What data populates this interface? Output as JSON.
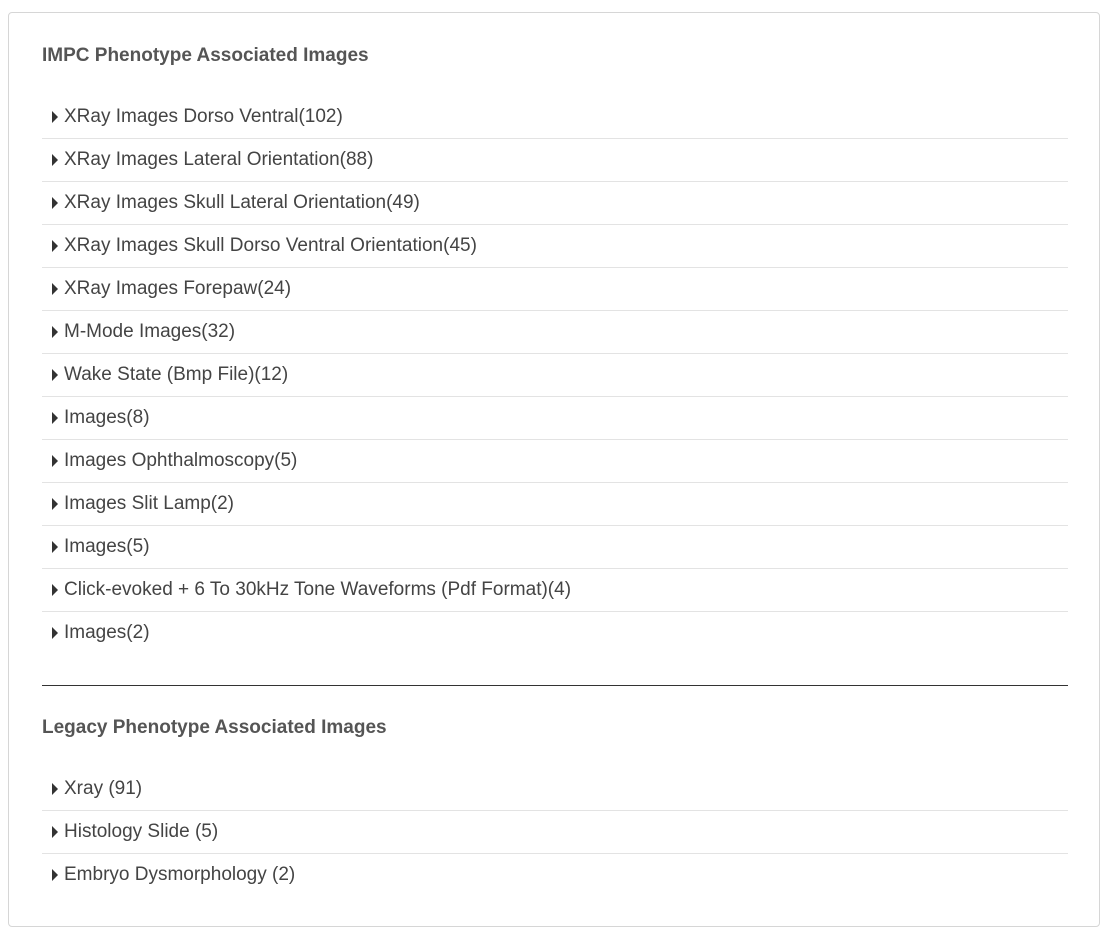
{
  "impc": {
    "title": "IMPC Phenotype Associated Images",
    "items": [
      {
        "label": "XRay Images Dorso Ventral(102)"
      },
      {
        "label": "XRay Images Lateral Orientation(88)"
      },
      {
        "label": "XRay Images Skull Lateral Orientation(49)"
      },
      {
        "label": "XRay Images Skull Dorso Ventral Orientation(45)"
      },
      {
        "label": "XRay Images Forepaw(24)"
      },
      {
        "label": "M-Mode Images(32)"
      },
      {
        "label": "Wake State (Bmp File)(12)"
      },
      {
        "label": "Images(8)"
      },
      {
        "label": "Images Ophthalmoscopy(5)"
      },
      {
        "label": "Images Slit Lamp(2)"
      },
      {
        "label": "Images(5)"
      },
      {
        "label": "Click-evoked + 6 To 30kHz Tone Waveforms (Pdf Format)(4)"
      },
      {
        "label": "Images(2)"
      }
    ]
  },
  "legacy": {
    "title": "Legacy Phenotype Associated Images",
    "items": [
      {
        "label": "Xray (91)"
      },
      {
        "label": "Histology Slide (5)"
      },
      {
        "label": "Embryo Dysmorphology (2)"
      }
    ]
  },
  "icons": {
    "expander": "caret-right-icon"
  },
  "colors": {
    "title": "#555555",
    "text": "#444444",
    "border": "#d6d6d6",
    "row_divider": "#e3e3e3",
    "section_divider": "#333333"
  }
}
